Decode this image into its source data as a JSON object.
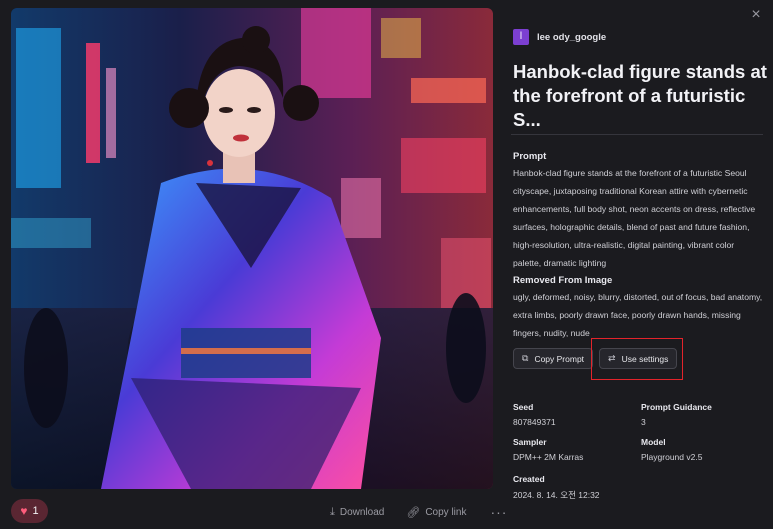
{
  "close_icon": "×",
  "user": {
    "avatar_letter": "l",
    "name": "lee ody_google"
  },
  "title": "Hanbok-clad figure stands at the forefront of a futuristic S...",
  "prompt": {
    "label": "Prompt",
    "text": "Hanbok-clad figure stands at the forefront of a futuristic Seoul cityscape, juxtaposing traditional Korean attire with cybernetic enhancements, full body shot, neon accents on dress, reflective surfaces, holographic details, blend of past and future fashion, high-resolution, ultra-realistic, digital painting, vibrant color palette, dramatic lighting"
  },
  "removed": {
    "label": "Removed From Image",
    "text": "ugly, deformed, noisy, blurry, distorted, out of focus, bad anatomy, extra limbs, poorly drawn face, poorly drawn hands, missing fingers, nudity, nude"
  },
  "buttons": {
    "copy_prompt": "Copy Prompt",
    "use_settings": "Use settings"
  },
  "meta": {
    "seed_label": "Seed",
    "seed_value": "807849371",
    "guidance_label": "Prompt Guidance",
    "guidance_value": "3",
    "sampler_label": "Sampler",
    "sampler_value": "DPM++ 2M Karras",
    "model_label": "Model",
    "model_value": "Playground v2.5",
    "created_label": "Created",
    "created_value": "2024. 8. 14. 오전 12:32"
  },
  "bottom": {
    "like_count": "1",
    "download_label": "Download",
    "copy_link_label": "Copy link",
    "more_label": "···"
  },
  "colors": {
    "accent_avatar": "#7c3fd1",
    "highlight": "#e3242b",
    "like_bg": "#5a2632"
  }
}
